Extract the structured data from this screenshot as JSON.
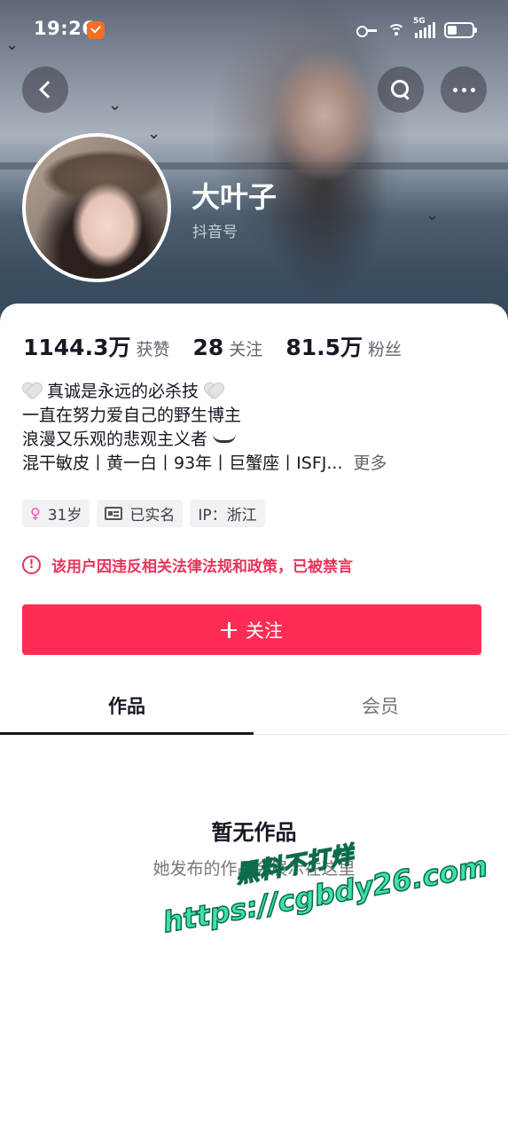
{
  "status_bar": {
    "time": "19:26",
    "network": "5G"
  },
  "profile": {
    "name": "大叶子",
    "douyin_id_label": "抖音号"
  },
  "stats": [
    {
      "value": "1144.3万",
      "label": "获赞"
    },
    {
      "value": "28",
      "label": "关注"
    },
    {
      "value": "81.5万",
      "label": "粉丝"
    }
  ],
  "bio": {
    "line1": "真诚是永远的必杀技",
    "line2": "一直在努力爱自己的野生博主",
    "line3": "浪漫又乐观的悲观主义者",
    "line4": "混干敏皮丨黄一白丨93年丨巨蟹座丨ISFJ...",
    "more": "更多"
  },
  "tags": {
    "age": "31岁",
    "verified": "已实名",
    "ip": "IP：浙江"
  },
  "ban_notice": "该用户因违反相关法律法规和政策，已被禁言",
  "follow_button": "关注",
  "tabs": [
    {
      "label": "作品",
      "active": true
    },
    {
      "label": "会员",
      "active": false
    }
  ],
  "empty_state": {
    "title": "暂无作品",
    "subtitle": "她发布的作品会展示在这里"
  },
  "watermark": {
    "line1": "黑料不打烊",
    "line2": "https://cgbdy26.com"
  },
  "colors": {
    "accent": "#fe2c55",
    "warning": "#e8335a",
    "watermark": "#3fe0a8"
  }
}
